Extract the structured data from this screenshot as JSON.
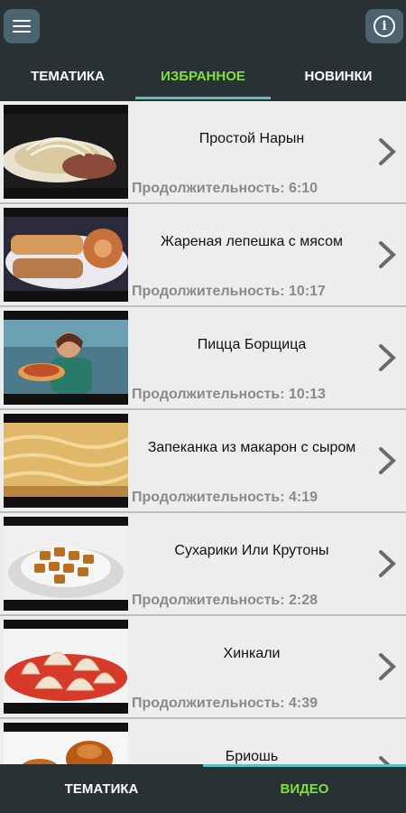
{
  "header": {
    "menu_icon": "hamburger-menu-icon",
    "info_icon": "info-icon",
    "info_glyph": "i"
  },
  "tabs": [
    {
      "label": "ТЕМАТИКА",
      "active": false
    },
    {
      "label": "ИЗБРАННОЕ",
      "active": true
    },
    {
      "label": "НОВИНКИ",
      "active": false
    }
  ],
  "videos": [
    {
      "title": "Простой Нарын",
      "duration": "Продолжительность: 6:10"
    },
    {
      "title": "Жареная лепешка с мясом",
      "duration": "Продолжительность: 10:17"
    },
    {
      "title": "Пицца Борщица",
      "duration": "Продолжительность: 10:13"
    },
    {
      "title": "Запеканка из макарон с сыром",
      "duration": "Продолжительность: 4:19"
    },
    {
      "title": "Сухарики Или Крутоны",
      "duration": "Продолжительность: 2:28"
    },
    {
      "title": "Хинкали",
      "duration": "Продолжительность: 4:39"
    },
    {
      "title": "Бриошь",
      "duration": ""
    }
  ],
  "bottom_nav": [
    {
      "label": "ТЕМАТИКА",
      "active": false
    },
    {
      "label": "ВИДЕО",
      "active": true
    }
  ],
  "colors": {
    "bar_bg": "#2a3135",
    "active_text": "#7fe13a",
    "indicator": "#58c4c2",
    "row_bg": "#ededed"
  }
}
